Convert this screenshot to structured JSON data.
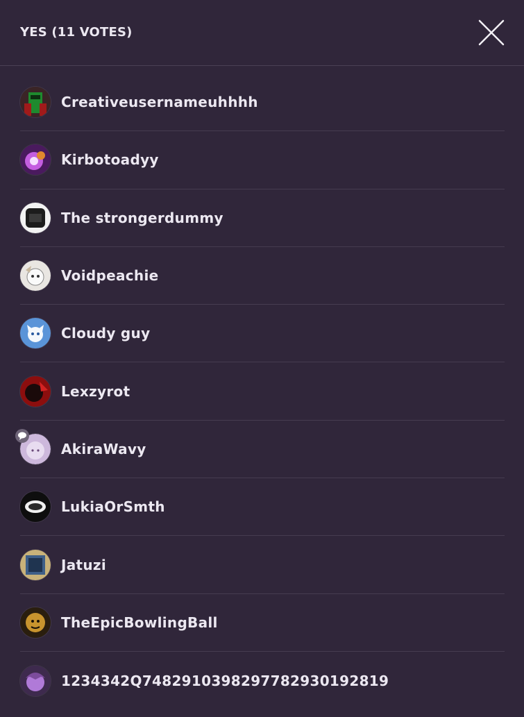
{
  "header": {
    "title": "YES (11 VOTES)"
  },
  "voters": [
    {
      "name": "Creativeusernameuhhhh",
      "avatar_color": "#2b1e1e"
    },
    {
      "name": "Kirbotoadyy",
      "avatar_color": "#5a1e6e"
    },
    {
      "name": "The strongerdummy",
      "avatar_color": "#f1f1f1"
    },
    {
      "name": "Voidpeachie",
      "avatar_color": "#e9e6e2"
    },
    {
      "name": "Cloudy guy",
      "avatar_color": "#4a84c8"
    },
    {
      "name": "Lexzyrot",
      "avatar_color": "#a01414"
    },
    {
      "name": "AkiraWavy",
      "avatar_color": "#d8c8e4"
    },
    {
      "name": "LukiaOrSmth",
      "avatar_color": "#111111"
    },
    {
      "name": "Jatuzi",
      "avatar_color": "#3e5f88"
    },
    {
      "name": "TheEpicBowlingBall",
      "avatar_color": "#6a4c1c"
    },
    {
      "name": "1234342Q748291039829778293019281​9",
      "avatar_color": "#7c4c9c"
    }
  ],
  "icons": {
    "close": "close-icon",
    "status": "speech-bubble-icon"
  }
}
